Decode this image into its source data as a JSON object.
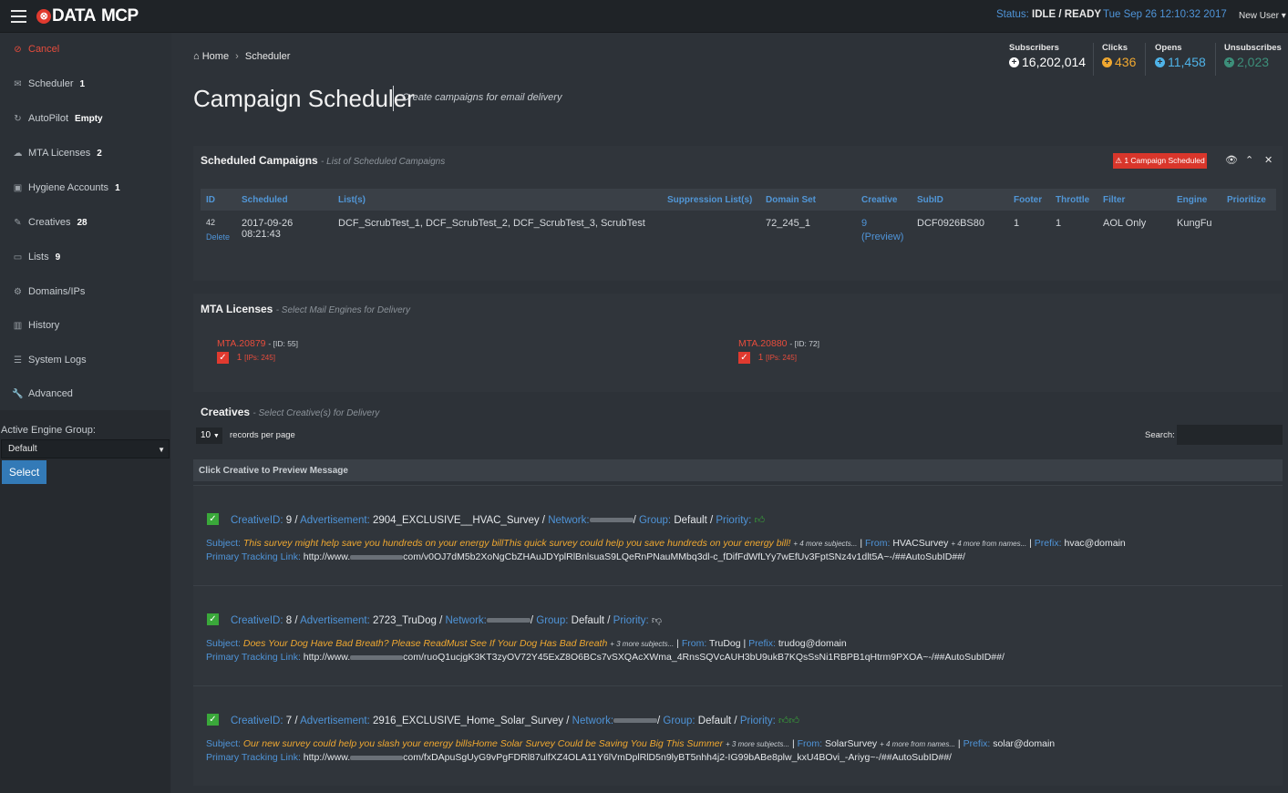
{
  "app": {
    "logo": "DATA",
    "logo_suffix": "MCP",
    "status_label": "Status:",
    "status_value": "IDLE / READY",
    "datetime": "Tue Sep 26 12:10:32 2017",
    "user_menu": "New User"
  },
  "sidebar": {
    "items": [
      {
        "label": "Cancel",
        "badge": "",
        "icon": "cancel-icon"
      },
      {
        "label": "Scheduler",
        "badge": "1",
        "icon": "envelope-icon"
      },
      {
        "label": "AutoPilot",
        "badge": "Empty",
        "icon": "refresh-icon"
      },
      {
        "label": "MTA Licenses",
        "badge": "2",
        "icon": "cloud-icon"
      },
      {
        "label": "Hygiene Accounts",
        "badge": "1",
        "icon": "briefcase-icon"
      },
      {
        "label": "Creatives",
        "badge": "28",
        "icon": "edit-icon"
      },
      {
        "label": "Lists",
        "badge": "9",
        "icon": "folder-icon"
      },
      {
        "label": "Domains/IPs",
        "badge": "",
        "icon": "cogs-icon"
      },
      {
        "label": "History",
        "badge": "",
        "icon": "bar-chart-icon"
      },
      {
        "label": "System Logs",
        "badge": "",
        "icon": "list-icon"
      },
      {
        "label": "Advanced",
        "badge": "",
        "icon": "wrench-icon"
      }
    ],
    "engine_group_label": "Active Engine Group:",
    "engine_group_value": "Default",
    "select_button": "Select"
  },
  "breadcrumb": {
    "home": "Home",
    "current": "Scheduler"
  },
  "page": {
    "title": "Campaign Scheduler",
    "subtitle": "Create campaigns for email delivery"
  },
  "stats": [
    {
      "label": "Subscribers",
      "value": "16,202,014",
      "color": "#ffffff"
    },
    {
      "label": "Clicks",
      "value": "436",
      "color": "#f0a830"
    },
    {
      "label": "Opens",
      "value": "11,458",
      "color": "#4fb3e8"
    },
    {
      "label": "Unsubscribes",
      "value": "2,023",
      "color": "#3d8f7a"
    }
  ],
  "scheduled": {
    "title": "Scheduled Campaigns",
    "subtitle": "- List of Scheduled Campaigns",
    "alert": "1 Campaign Scheduled",
    "columns": [
      "ID",
      "Scheduled",
      "List(s)",
      "Suppression List(s)",
      "Domain Set",
      "Creative",
      "SubID",
      "Footer",
      "Throttle",
      "Filter",
      "Engine",
      "Prioritize"
    ],
    "row": {
      "id": "42",
      "delete": "Delete",
      "scheduled": "2017-09-26 08:21:43",
      "lists": "DCF_ScrubTest_1, DCF_ScrubTest_2, DCF_ScrubTest_3, ScrubTest",
      "suppression": "",
      "domain_set": "72_245_1",
      "creative": "9",
      "creative_preview": "(Preview)",
      "subid": "DCF0926BS80",
      "footer": "1",
      "throttle": "1",
      "filter": "AOL Only",
      "engine": "KungFu",
      "prioritize": ""
    }
  },
  "mta": {
    "title": "MTA Licenses",
    "subtitle": "- Select Mail Engines for Delivery",
    "licenses": [
      {
        "name": "MTA.20879",
        "id": "- [ID: 55]",
        "count": "1",
        "ips": "[IPs: 245]"
      },
      {
        "name": "MTA.20880",
        "id": "- [ID: 72]",
        "count": "1",
        "ips": "[IPs: 245]"
      }
    ]
  },
  "creatives": {
    "title": "Creatives",
    "subtitle": "- Select Creative(s) for Delivery",
    "per_page": "10",
    "per_page_label": "records per page",
    "search_label": "Search:",
    "search_value": "",
    "preview_hint": "Click Creative to Preview Message",
    "items": [
      {
        "id": "9",
        "ad": "2904_EXCLUSIVE__HVAC_Survey",
        "group": "Default",
        "subject": "This survey might help save you hundreds on your energy billThis quick survey could help you save hundreds on your energy bill!",
        "more_subjects": "+ 4 more subjects...",
        "from": "HVACSurvey",
        "more_from": "+ 4 more from names...",
        "prefix": "hvac@domain",
        "link_a": "http://www.",
        "link_b": "com/v0OJ7dM5b2XoNgCbZHAuJDYplRlBnlsuaS9LQeRnPNauMMbq3dl-c_fDifFdWfLYy7wEfUv3FptSNz4v1dlt5A~-/##AutoSubID##/",
        "priority": "thumbs-up"
      },
      {
        "id": "8",
        "ad": "2723_TruDog",
        "group": "Default",
        "subject": "Does Your Dog Have Bad Breath? Please ReadMust See If Your Dog Has Bad Breath",
        "more_subjects": "+ 3 more subjects...",
        "from": "TruDog",
        "more_from": "",
        "prefix": "trudog@domain",
        "link_a": "http://www.",
        "link_b": "com/ruoQ1ucjgK3KT3zyOV72Y45ExZ8O6BCs7vSXQAcXWma_4RnsSQVcAUH3bU9ukB7KQsSsNi1RBPB1qHtrm9PXOA~-/##AutoSubID##/",
        "priority": "thumbs-down"
      },
      {
        "id": "7",
        "ad": "2916_EXCLUSIVE_Home_Solar_Survey",
        "group": "Default",
        "subject": "Our new survey could help you slash your energy billsHome Solar Survey Could be Saving You Big This Summer",
        "more_subjects": "+ 3 more subjects...",
        "from": "SolarSurvey",
        "more_from": "+ 4 more from names...",
        "prefix": "solar@domain",
        "link_a": "http://www.",
        "link_b": "com/fxDApuSgUyG9vPgFDRl87ulfXZ4OLA11Y6lVmDplRlD5n9lyBT5nhh4j2-IG99bABe8plw_kxU4BOvi_-Ariyg~-/##AutoSubID##/",
        "priority": "thumbs-up-double"
      }
    ],
    "field_labels": {
      "creative_id": "CreativeID:",
      "advertisement": "Advertisement:",
      "network": "Network:",
      "group": "Group:",
      "priority": "Priority:",
      "subject": "Subject:",
      "from": "From:",
      "prefix": "Prefix:",
      "tracking": "Primary Tracking Link:"
    }
  }
}
